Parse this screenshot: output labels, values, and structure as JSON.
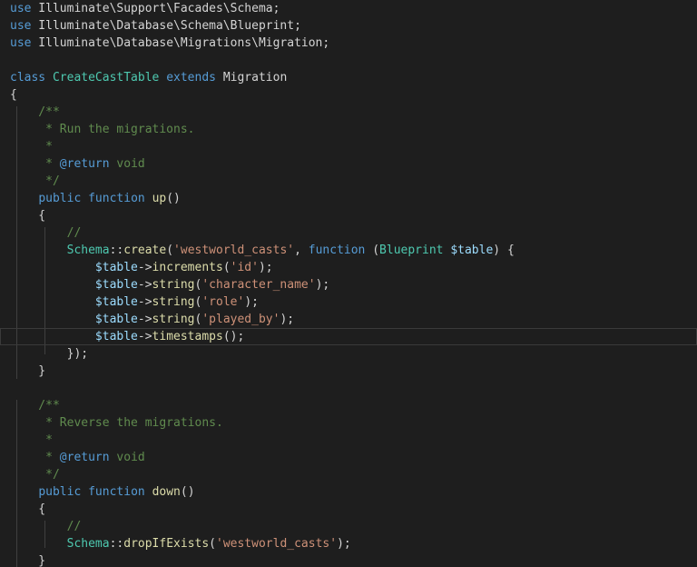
{
  "editor": {
    "lines": [
      {
        "tokens": [
          {
            "t": "use",
            "c": "kw"
          },
          {
            "t": " Illuminate\\Support\\Facades\\Schema;",
            "c": "plain"
          }
        ]
      },
      {
        "tokens": [
          {
            "t": "use",
            "c": "kw"
          },
          {
            "t": " Illuminate\\Database\\Schema\\Blueprint;",
            "c": "plain"
          }
        ]
      },
      {
        "tokens": [
          {
            "t": "use",
            "c": "kw"
          },
          {
            "t": " Illuminate\\Database\\Migrations\\Migration;",
            "c": "plain"
          }
        ]
      },
      {
        "tokens": []
      },
      {
        "tokens": [
          {
            "t": "class",
            "c": "kw"
          },
          {
            "t": " ",
            "c": "plain"
          },
          {
            "t": "CreateCastTable",
            "c": "type"
          },
          {
            "t": " ",
            "c": "plain"
          },
          {
            "t": "extends",
            "c": "kw"
          },
          {
            "t": " Migration",
            "c": "plain"
          }
        ]
      },
      {
        "tokens": [
          {
            "t": "{",
            "c": "pn"
          }
        ]
      },
      {
        "tokens": [
          {
            "t": "    /**",
            "c": "cm"
          }
        ]
      },
      {
        "tokens": [
          {
            "t": "     * Run the migrations.",
            "c": "cm"
          }
        ]
      },
      {
        "tokens": [
          {
            "t": "     *",
            "c": "cm"
          }
        ]
      },
      {
        "tokens": [
          {
            "t": "     * ",
            "c": "cm"
          },
          {
            "t": "@return",
            "c": "cmkw"
          },
          {
            "t": " void",
            "c": "cm"
          }
        ]
      },
      {
        "tokens": [
          {
            "t": "     */",
            "c": "cm"
          }
        ]
      },
      {
        "tokens": [
          {
            "t": "    ",
            "c": "plain"
          },
          {
            "t": "public",
            "c": "kw"
          },
          {
            "t": " ",
            "c": "plain"
          },
          {
            "t": "function",
            "c": "kw"
          },
          {
            "t": " ",
            "c": "plain"
          },
          {
            "t": "up",
            "c": "fn"
          },
          {
            "t": "()",
            "c": "pn"
          }
        ]
      },
      {
        "tokens": [
          {
            "t": "    {",
            "c": "pn"
          }
        ]
      },
      {
        "tokens": [
          {
            "t": "        //",
            "c": "cm"
          }
        ]
      },
      {
        "tokens": [
          {
            "t": "        ",
            "c": "plain"
          },
          {
            "t": "Schema",
            "c": "type"
          },
          {
            "t": "::",
            "c": "pn"
          },
          {
            "t": "create",
            "c": "fn"
          },
          {
            "t": "(",
            "c": "pn"
          },
          {
            "t": "'westworld_casts'",
            "c": "str"
          },
          {
            "t": ", ",
            "c": "pn"
          },
          {
            "t": "function",
            "c": "kw"
          },
          {
            "t": " (",
            "c": "pn"
          },
          {
            "t": "Blueprint",
            "c": "type"
          },
          {
            "t": " ",
            "c": "plain"
          },
          {
            "t": "$table",
            "c": "var"
          },
          {
            "t": ") {",
            "c": "pn"
          }
        ]
      },
      {
        "tokens": [
          {
            "t": "            ",
            "c": "plain"
          },
          {
            "t": "$table",
            "c": "var"
          },
          {
            "t": "->",
            "c": "pn"
          },
          {
            "t": "increments",
            "c": "fn"
          },
          {
            "t": "(",
            "c": "pn"
          },
          {
            "t": "'id'",
            "c": "str"
          },
          {
            "t": ");",
            "c": "pn"
          }
        ]
      },
      {
        "tokens": [
          {
            "t": "            ",
            "c": "plain"
          },
          {
            "t": "$table",
            "c": "var"
          },
          {
            "t": "->",
            "c": "pn"
          },
          {
            "t": "string",
            "c": "fn"
          },
          {
            "t": "(",
            "c": "pn"
          },
          {
            "t": "'character_name'",
            "c": "str"
          },
          {
            "t": ");",
            "c": "pn"
          }
        ]
      },
      {
        "tokens": [
          {
            "t": "            ",
            "c": "plain"
          },
          {
            "t": "$table",
            "c": "var"
          },
          {
            "t": "->",
            "c": "pn"
          },
          {
            "t": "string",
            "c": "fn"
          },
          {
            "t": "(",
            "c": "pn"
          },
          {
            "t": "'role'",
            "c": "str"
          },
          {
            "t": ");",
            "c": "pn"
          }
        ]
      },
      {
        "tokens": [
          {
            "t": "            ",
            "c": "plain"
          },
          {
            "t": "$table",
            "c": "var"
          },
          {
            "t": "->",
            "c": "pn"
          },
          {
            "t": "string",
            "c": "fn"
          },
          {
            "t": "(",
            "c": "pn"
          },
          {
            "t": "'played_by'",
            "c": "str"
          },
          {
            "t": ");",
            "c": "pn"
          }
        ]
      },
      {
        "tokens": [
          {
            "t": "            ",
            "c": "plain"
          },
          {
            "t": "$table",
            "c": "var"
          },
          {
            "t": "->",
            "c": "pn"
          },
          {
            "t": "timestamps",
            "c": "fn"
          },
          {
            "t": "();",
            "c": "pn"
          }
        ],
        "current": true
      },
      {
        "tokens": [
          {
            "t": "        });",
            "c": "pn"
          }
        ]
      },
      {
        "tokens": [
          {
            "t": "    }",
            "c": "pn"
          }
        ]
      },
      {
        "tokens": []
      },
      {
        "tokens": [
          {
            "t": "    /**",
            "c": "cm"
          }
        ]
      },
      {
        "tokens": [
          {
            "t": "     * Reverse the migrations.",
            "c": "cm"
          }
        ]
      },
      {
        "tokens": [
          {
            "t": "     *",
            "c": "cm"
          }
        ]
      },
      {
        "tokens": [
          {
            "t": "     * ",
            "c": "cm"
          },
          {
            "t": "@return",
            "c": "cmkw"
          },
          {
            "t": " void",
            "c": "cm"
          }
        ]
      },
      {
        "tokens": [
          {
            "t": "     */",
            "c": "cm"
          }
        ]
      },
      {
        "tokens": [
          {
            "t": "    ",
            "c": "plain"
          },
          {
            "t": "public",
            "c": "kw"
          },
          {
            "t": " ",
            "c": "plain"
          },
          {
            "t": "function",
            "c": "kw"
          },
          {
            "t": " ",
            "c": "plain"
          },
          {
            "t": "down",
            "c": "fn"
          },
          {
            "t": "()",
            "c": "pn"
          }
        ]
      },
      {
        "tokens": [
          {
            "t": "    {",
            "c": "pn"
          }
        ]
      },
      {
        "tokens": [
          {
            "t": "        //",
            "c": "cm"
          }
        ]
      },
      {
        "tokens": [
          {
            "t": "        ",
            "c": "plain"
          },
          {
            "t": "Schema",
            "c": "type"
          },
          {
            "t": "::",
            "c": "pn"
          },
          {
            "t": "dropIfExists",
            "c": "fn"
          },
          {
            "t": "(",
            "c": "pn"
          },
          {
            "t": "'westworld_casts'",
            "c": "str"
          },
          {
            "t": ");",
            "c": "pn"
          }
        ]
      },
      {
        "tokens": [
          {
            "t": "    }",
            "c": "pn"
          }
        ]
      }
    ]
  }
}
